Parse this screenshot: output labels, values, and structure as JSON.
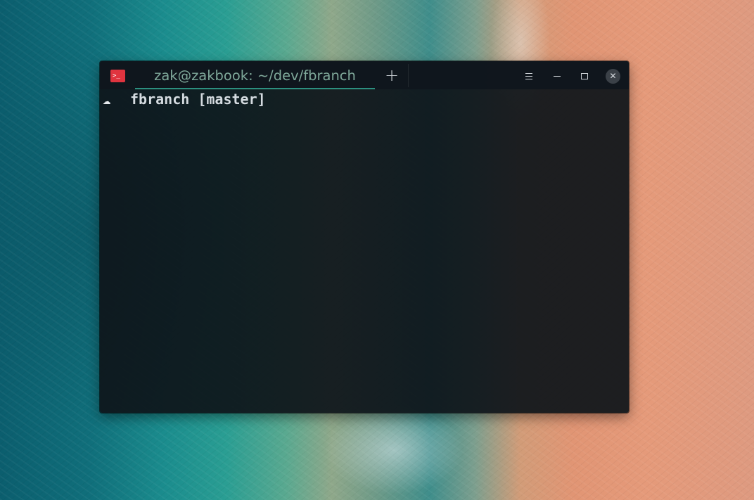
{
  "terminal_window": {
    "tab_title": "zak@zakbook: ~/dev/fbranch",
    "app_icon_glyph": ">_",
    "new_tab_glyph": "+",
    "close_glyph": "✕",
    "prompt": {
      "glyph": "☁",
      "directory": "fbranch",
      "branch": "[master]"
    },
    "colors": {
      "tab_text": "#7fa89a",
      "tab_underline": "#2c8f7f",
      "app_icon_bg": "#e0343f",
      "terminal_bg": "#0e141a",
      "prompt_text": "#d5dbe0"
    }
  }
}
